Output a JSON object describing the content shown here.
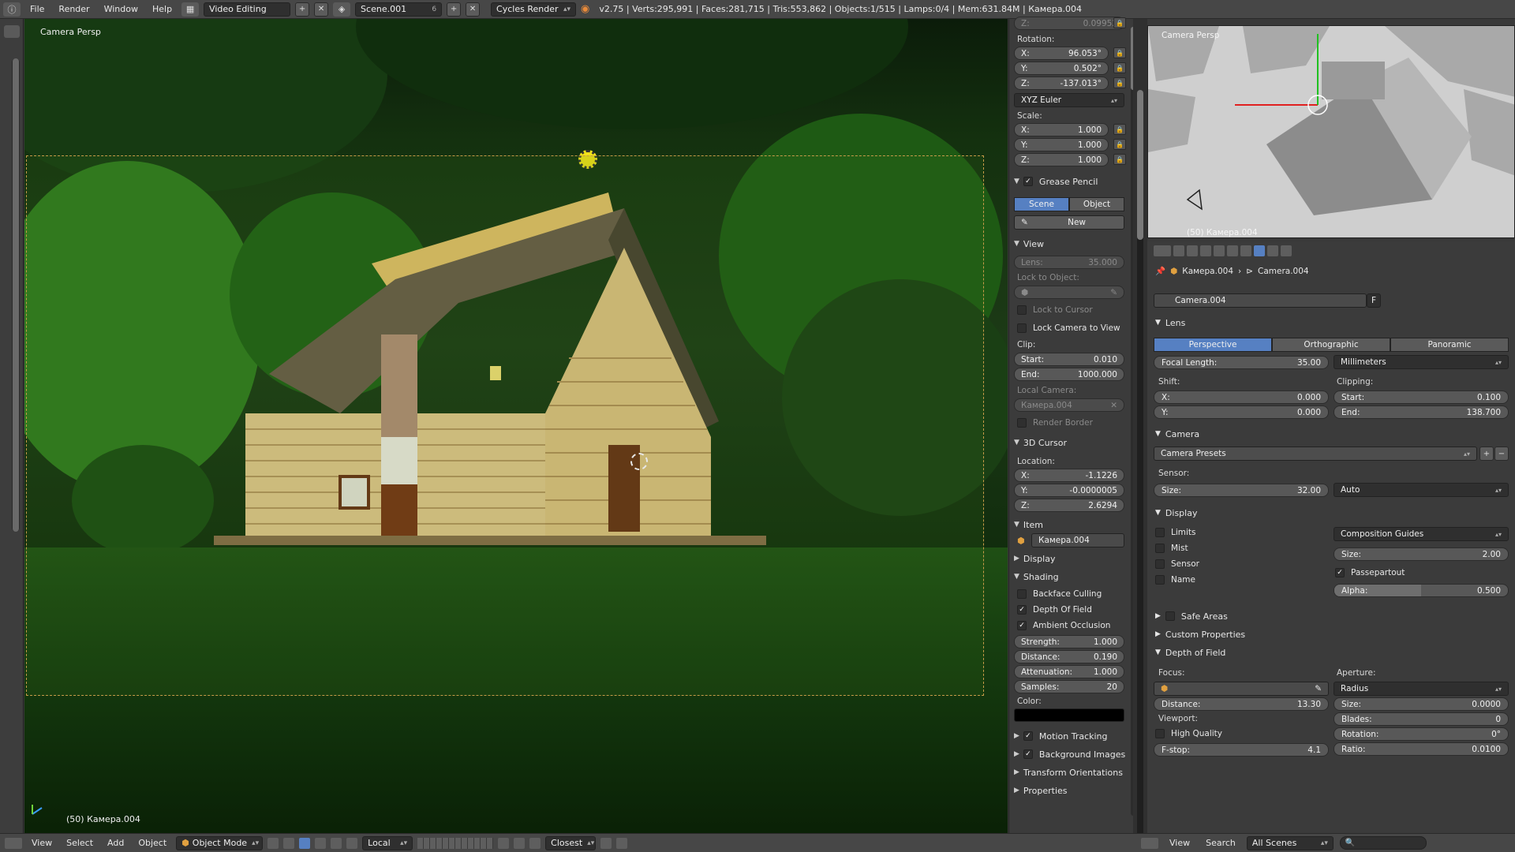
{
  "topbar": {
    "menus": [
      "File",
      "Render",
      "Window",
      "Help"
    ],
    "screen_layout": "Video Editing",
    "scene": "Scene.001",
    "scene_users": "6",
    "render_engine": "Cycles Render",
    "stats": "v2.75 | Verts:295,991 | Faces:281,715 | Tris:553,862 | Objects:1/515 | Lamps:0/4 | Mem:631.84M | Камера.004"
  },
  "viewport": {
    "view_label": "Camera Persp",
    "object_label": "(50) Камера.004"
  },
  "npanel": {
    "loc_z": {
      "label": "Z:",
      "value": "0.09952"
    },
    "rotation_label": "Rotation:",
    "rotation": [
      {
        "label": "X:",
        "value": "96.053°"
      },
      {
        "label": "Y:",
        "value": "0.502°"
      },
      {
        "label": "Z:",
        "value": "-137.013°"
      }
    ],
    "rotation_mode": "XYZ Euler",
    "scale_label": "Scale:",
    "scale": [
      {
        "label": "X:",
        "value": "1.000"
      },
      {
        "label": "Y:",
        "value": "1.000"
      },
      {
        "label": "Z:",
        "value": "1.000"
      }
    ],
    "grease_pencil": {
      "header": "Grease Pencil",
      "tab_scene": "Scene",
      "tab_object": "Object",
      "new_label": "New"
    },
    "view": {
      "header": "View",
      "lens_label": "Lens:",
      "lens_value": "35.000",
      "lock_to_object": "Lock to Object:",
      "lock_to_cursor": "Lock to Cursor",
      "lock_camera_to_view": "Lock Camera to View",
      "clip_label": "Clip:",
      "clip_start_label": "Start:",
      "clip_start": "0.010",
      "clip_end_label": "End:",
      "clip_end": "1000.000",
      "local_camera_label": "Local Camera:",
      "local_camera": "Камера.004",
      "render_border": "Render Border"
    },
    "cursor": {
      "header": "3D Cursor",
      "location_label": "Location:",
      "values": [
        {
          "label": "X:",
          "value": "-1.1226"
        },
        {
          "label": "Y:",
          "value": "-0.0000005"
        },
        {
          "label": "Z:",
          "value": "2.6294"
        }
      ]
    },
    "item": {
      "header": "Item",
      "name": "Камера.004"
    },
    "display_header": "Display",
    "shading": {
      "header": "Shading",
      "backface_culling": "Backface Culling",
      "depth_of_field": "Depth Of Field",
      "ambient_occlusion": "Ambient Occlusion",
      "fields": [
        {
          "label": "Strength:",
          "value": "1.000"
        },
        {
          "label": "Distance:",
          "value": "0.190"
        },
        {
          "label": "Attenuation:",
          "value": "1.000"
        },
        {
          "label": "Samples:",
          "value": "20"
        }
      ],
      "color_label": "Color:",
      "color_value": "#000000"
    },
    "bottom_headers": [
      "Motion Tracking",
      "Background Images",
      "Transform Orientations",
      "Properties"
    ]
  },
  "preview": {
    "view_label": "Camera Persp",
    "sub_label": "(50) Камера.004"
  },
  "props": {
    "breadcrumb_object": "Камера.004",
    "breadcrumb_data": "Camera.004",
    "datablock_name": "Camera.004",
    "datablock_fake": "F",
    "lens": {
      "header": "Lens",
      "tabs": [
        "Perspective",
        "Orthographic",
        "Panoramic"
      ],
      "focal_label": "Focal Length:",
      "focal_value": "35.00",
      "unit": "Millimeters",
      "shift_label": "Shift:",
      "shift_x_label": "X:",
      "shift_x": "0.000",
      "shift_y_label": "Y:",
      "shift_y": "0.000",
      "clipping_label": "Clipping:",
      "clip_start_label": "Start:",
      "clip_start": "0.100",
      "clip_end_label": "End:",
      "clip_end": "138.700"
    },
    "camera": {
      "header": "Camera",
      "presets": "Camera Presets",
      "sensor_label": "Sensor:",
      "size_label": "Size:",
      "size_value": "32.00",
      "fit": "Auto"
    },
    "display": {
      "header": "Display",
      "limits": "Limits",
      "mist": "Mist",
      "sensor": "Sensor",
      "name": "Name",
      "composition": "Composition Guides",
      "size_label": "Size:",
      "size_value": "2.00",
      "passepartout": "Passepartout",
      "alpha_label": "Alpha:",
      "alpha_value": "0.500",
      "alpha_fraction": 0.5
    },
    "safe_areas": "Safe Areas",
    "custom_properties": "Custom Properties",
    "dof": {
      "header": "Depth of Field",
      "focus_label": "Focus:",
      "distance_label": "Distance:",
      "distance_value": "13.30",
      "viewport_label": "Viewport:",
      "high_quality": "High Quality",
      "fstop_label": "F-stop:",
      "fstop_value": "4.1",
      "aperture_label": "Aperture:",
      "aperture_type": "Radius",
      "size_label": "Size:",
      "size_value": "0.0000",
      "blades_label": "Blades:",
      "blades_value": "0",
      "rotation_label": "Rotation:",
      "rotation_value": "0°",
      "ratio_label": "Ratio:",
      "ratio_value": "0.0100"
    }
  },
  "bottombar_left": {
    "menus": [
      "View",
      "Select",
      "Add",
      "Object"
    ],
    "mode": "Object Mode",
    "orientation": "Local",
    "snap": "Closest"
  },
  "bottombar_right": {
    "menus": [
      "View",
      "Search"
    ],
    "scenes": "All Scenes"
  },
  "colors": {
    "accent_blue": "#5680c2",
    "camera_frame": "#c69a48",
    "viewport_green": "#1c3a16"
  }
}
